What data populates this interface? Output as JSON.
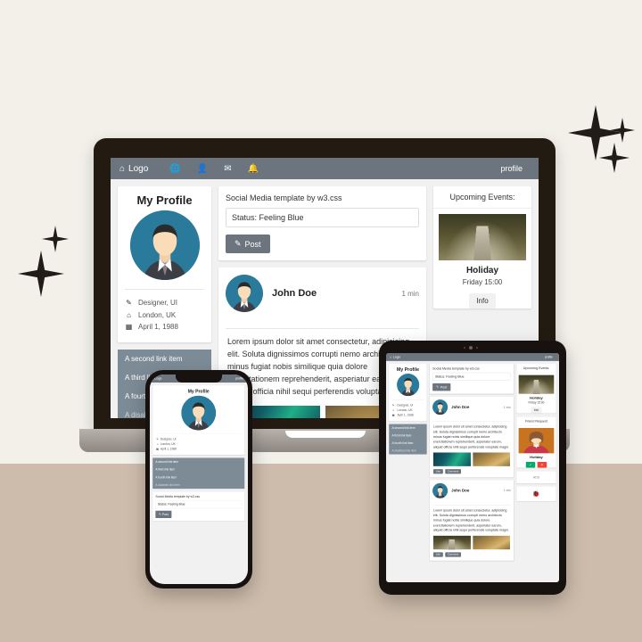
{
  "background": {
    "top_color": "#f3f0ea",
    "bottom_color": "#cdbcab"
  },
  "navbar": {
    "brand_label": "Logo",
    "brand_icon": "home-icon",
    "icons": [
      {
        "name": "globe-icon",
        "glyph": "ἱ0"
      },
      {
        "name": "user-icon",
        "glyph": "὆4"
      },
      {
        "name": "envelope-icon",
        "glyph": "✉"
      },
      {
        "name": "bell-icon",
        "glyph": "ὑ4"
      }
    ],
    "right_label": "profile"
  },
  "profile_card": {
    "title": "My Profile",
    "avatar_name": "avatar-illustration",
    "meta": [
      {
        "icon": "pencil-icon",
        "text": "Designer, UI"
      },
      {
        "icon": "home-icon",
        "text": "London, UK"
      },
      {
        "icon": "calendar-icon",
        "text": "April 1, 1988"
      }
    ]
  },
  "link_list": [
    {
      "label": "A second link item",
      "disabled": false
    },
    {
      "label": "A third link item",
      "disabled": false
    },
    {
      "label": "A fourth link item",
      "disabled": false
    },
    {
      "label": "A disabled link item",
      "disabled": true
    }
  ],
  "composer": {
    "heading": "Social Media template by w3.css",
    "status_value": "Status: Feeling Blue",
    "status_placeholder": "Status",
    "post_button": "Post",
    "post_icon": "pencil-icon"
  },
  "feed_post": {
    "author": "John Doe",
    "time": "1 min",
    "body": "Lorem ipsum dolor sit amet consectetur, adipisicing elit. Soluta dignissimos corrupti nemo architecto minus fugiat nobis similique quia dolore exercitationem reprehenderit, asperiatur earum, aliquid officia nihil sequi perferendis voluptate magni.",
    "images": [
      {
        "name": "post-image-aurora"
      },
      {
        "name": "post-image-canyon"
      }
    ],
    "actions": [
      {
        "label": "Like",
        "icon": "thumbs-up-icon"
      },
      {
        "label": "Comment",
        "icon": "comment-icon"
      }
    ]
  },
  "upcoming_events": {
    "title": "Upcoming Events:",
    "image_name": "event-image-forest-bridge",
    "event_name": "Holiday",
    "event_time": "Friday 15:00",
    "info_button": "Info"
  },
  "friend_request": {
    "title": "Friend Request",
    "image_name": "friend-photo",
    "person_name": "Holiday",
    "accept_icon": "check-icon",
    "decline_icon": "close-icon"
  },
  "ads_card": {
    "label": "ADS"
  },
  "bug_card": {
    "icon_name": "bug-icon",
    "glyph": "🐞"
  },
  "devices": {
    "laptop_name": "laptop-mockup",
    "phone_name": "phone-mockup",
    "tablet_name": "tablet-mockup"
  },
  "decor": {
    "sparkle_count": 5,
    "sparkle_color": "#211c17"
  }
}
